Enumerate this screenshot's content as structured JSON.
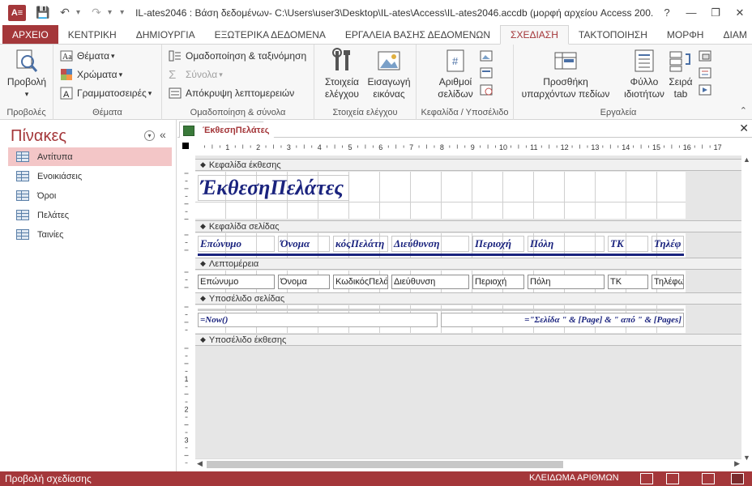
{
  "titlebar": {
    "app_icon": "A≡",
    "window_title": "IL-ates2046 : Βάση δεδομένων- C:\\Users\\user3\\Desktop\\IL-ates\\Access\\IL-ates2046.accdb (μορφή αρχείου Access 200...",
    "help": "?",
    "minimize": "—",
    "restore": "❐",
    "close": "✕"
  },
  "tabs": [
    "ΑΡΧΕΙΟ",
    "ΚΕΝΤΡΙΚΗ",
    "ΔΗΜΙΟΥΡΓΙΑ",
    "ΕΞΩΤΕΡΙΚΑ ΔΕΔΟΜΕΝΑ",
    "ΕΡΓΑΛΕΙΑ ΒΑΣΗΣ ΔΕΔΟΜΕΝΩΝ",
    "ΣΧΕΔΙΑΣΗ",
    "ΤΑΚΤΟΠΟΙΗΣΗ",
    "ΜΟΡΦΗ",
    "ΔΙΑΜ"
  ],
  "ribbon": {
    "views": {
      "button": "Προβολή",
      "group": "Προβολές"
    },
    "themes": {
      "themes": "Θέματα",
      "colors": "Χρώματα",
      "fonts": "Γραμματοσειρές",
      "group": "Θέματα"
    },
    "grouping": {
      "group_sort": "Ομαδοποίηση & ταξινόμηση",
      "totals": "Σύνολα",
      "hide_details": "Απόκρυψη λεπτομερειών",
      "group": "Ομαδοποίηση & σύνολα"
    },
    "controls": {
      "controls": "Στοιχεία ελέγχου",
      "insert_image": "Εισαγωγή εικόνας",
      "group": "Στοιχεία ελέγχου"
    },
    "header_footer": {
      "page_numbers": "Αριθμοί σελίδων",
      "group": "Κεφαλίδα / Υποσέλιδο"
    },
    "tools": {
      "add_fields": "Προσθήκη υπαρχόντων πεδίων",
      "property_sheet": "Φύλλο ιδιοτήτων",
      "tab_order": "Σειρά tab",
      "group": "Εργαλεία"
    }
  },
  "navpane": {
    "title": "Πίνακες",
    "items": [
      {
        "label": "Αντίτυπα",
        "selected": true
      },
      {
        "label": "Ενοικιάσεις",
        "selected": false
      },
      {
        "label": "Όροι",
        "selected": false
      },
      {
        "label": "Πελάτες",
        "selected": false
      },
      {
        "label": "Ταινίες",
        "selected": false
      }
    ]
  },
  "document": {
    "tab_label": "ΈκθεσηΠελάτες",
    "ruler_numbers": [
      "1",
      "2",
      "3",
      "4",
      "5",
      "6",
      "7",
      "8",
      "9",
      "10",
      "11",
      "12",
      "13",
      "14",
      "15",
      "16",
      "17"
    ],
    "left_ruler": [
      "1",
      "2",
      "3"
    ],
    "sections": {
      "report_header": "Κεφαλίδα έκθεσης",
      "page_header": "Κεφαλίδα σελίδας",
      "detail": "Λεπτομέρεια",
      "page_footer": "Υποσέλιδο σελίδας",
      "report_footer": "Υποσέλιδο έκθεσης"
    },
    "report_title": "ΈκθεσηΠελάτες",
    "header_labels": [
      "Επώνυμο",
      "Όνομα",
      "κόςΠελάτη",
      "Διεύθυνση",
      "Περιοχή",
      "Πόλη",
      "ΤΚ",
      "Τηλέφ"
    ],
    "detail_fields": [
      "Επώνυμο",
      "Όνομα",
      "ΚωδικόςΠελά",
      "Διεύθυνση",
      "Περιοχή",
      "Πόλη",
      "ΤΚ",
      "Τηλέφω"
    ],
    "footer_now": "=Now()",
    "footer_page": "=\"Σελίδα \" & [Page] & \" από \" & [Pages]"
  },
  "statusbar": {
    "left": "Προβολή σχεδίασης",
    "numlock": "ΚΛΕΙΔΩΜΑ ΑΡΙΘΜΩΝ"
  },
  "colors": {
    "accent": "#a4373a",
    "report_text": "#1a237e",
    "selected_nav": "#f3c6c7"
  }
}
